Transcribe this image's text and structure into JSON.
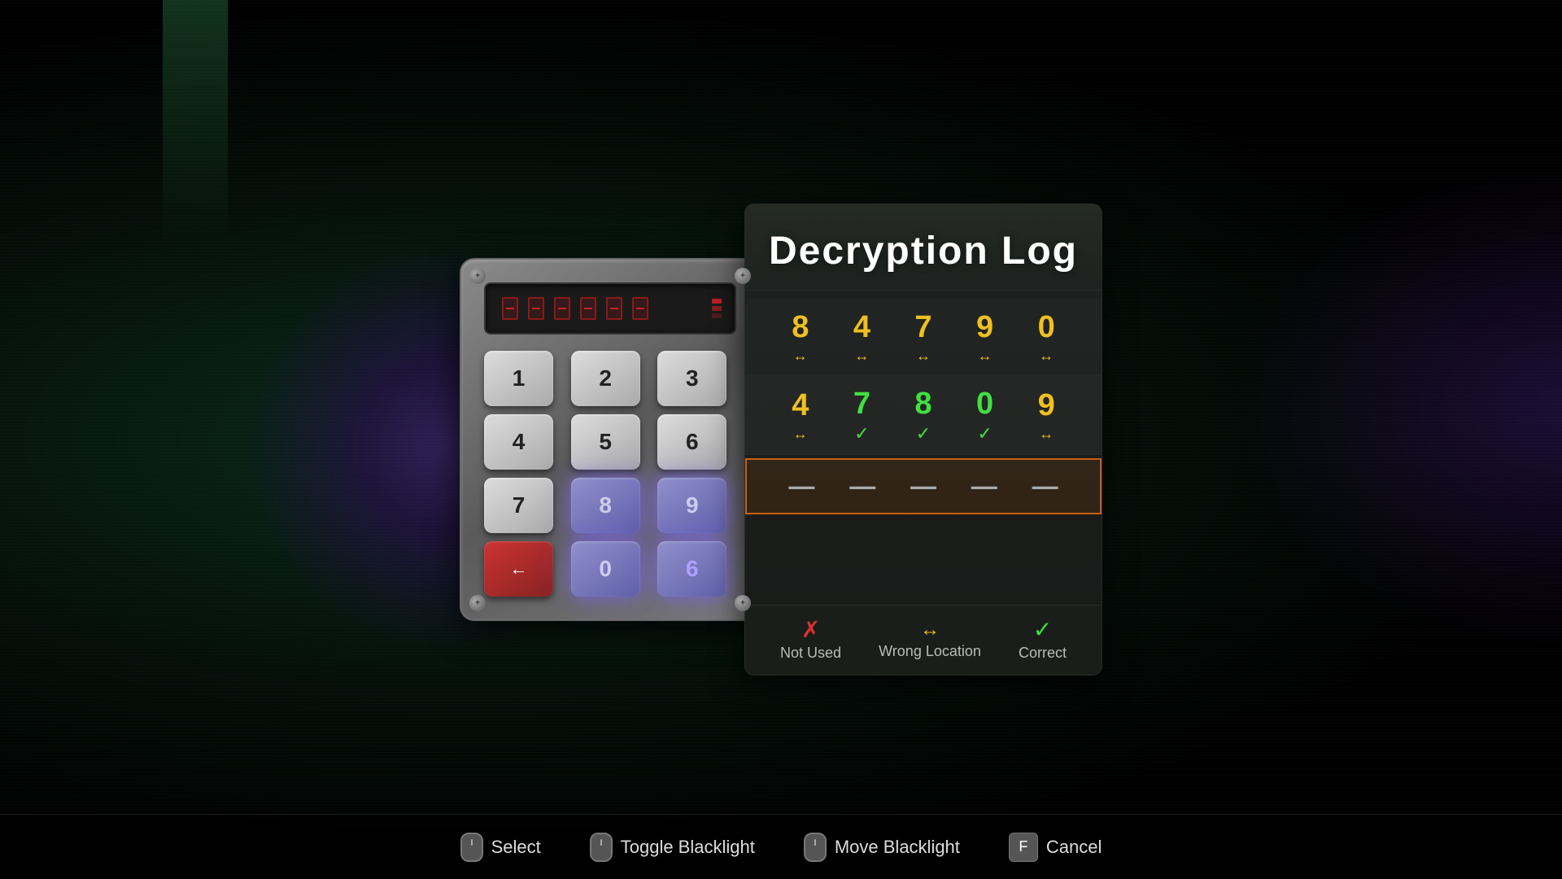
{
  "background": {
    "description": "dark game background with green and purple accents"
  },
  "title": "Decryption Log",
  "keypad": {
    "display": {
      "segments": 6,
      "label": "keypad-display"
    },
    "keys": [
      {
        "label": "1",
        "state": "normal"
      },
      {
        "label": "2",
        "state": "normal"
      },
      {
        "label": "3",
        "state": "normal"
      },
      {
        "label": "4",
        "state": "normal"
      },
      {
        "label": "5",
        "state": "normal"
      },
      {
        "label": "6",
        "state": "normal"
      },
      {
        "label": "7",
        "state": "normal"
      },
      {
        "label": "8",
        "state": "glowing"
      },
      {
        "label": "9",
        "state": "glowing"
      },
      {
        "label": "←",
        "state": "backspace"
      },
      {
        "label": "0",
        "state": "glowing"
      },
      {
        "label": "6",
        "state": "glowing"
      }
    ]
  },
  "log": {
    "title": "Decryption Log",
    "rows": [
      {
        "digits": [
          "8",
          "4",
          "7",
          "9",
          "0"
        ],
        "indicators": [
          "↔",
          "↔",
          "↔",
          "↔",
          "↔"
        ],
        "color": "yellow"
      },
      {
        "digits": [
          "4",
          "7",
          "8",
          "0",
          "9"
        ],
        "indicators": [
          "↔",
          "✓",
          "✓",
          "✓",
          "↔"
        ],
        "colors": [
          "yellow",
          "green",
          "green",
          "green",
          "yellow"
        ]
      }
    ],
    "active_row": [
      "—",
      "—",
      "—",
      "—",
      "—"
    ]
  },
  "legend": {
    "items": [
      {
        "icon": "✗",
        "label": "Not Used",
        "color": "red"
      },
      {
        "icon": "↔",
        "label": "Wrong Location",
        "color": "yellow"
      },
      {
        "icon": "✓",
        "label": "Correct",
        "color": "green"
      }
    ]
  },
  "bottom_bar": {
    "actions": [
      {
        "icon": "🖱",
        "type": "mouse-left",
        "label": "Select"
      },
      {
        "icon": "🖱",
        "type": "mouse-mid",
        "label": "Toggle Blacklight"
      },
      {
        "icon": "🖱",
        "type": "mouse-right",
        "label": "Move Blacklight"
      },
      {
        "icon": "F",
        "type": "keyboard",
        "label": "Cancel"
      }
    ]
  }
}
